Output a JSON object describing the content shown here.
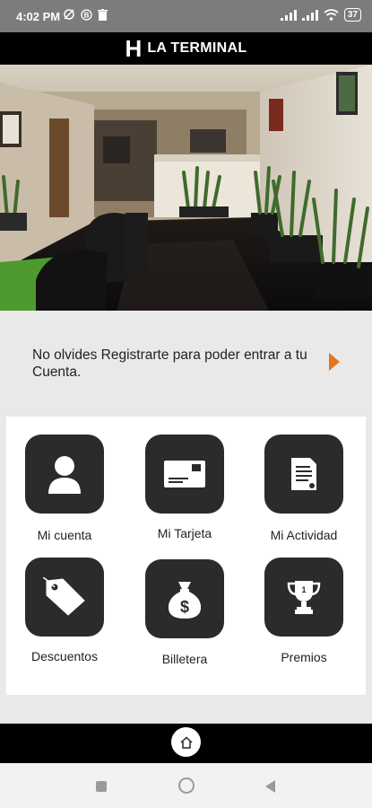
{
  "status_bar": {
    "time": "4:02 PM",
    "battery": "37",
    "icons": [
      "no-sync-icon",
      "b-badge-icon",
      "trash-icon",
      "signal-icon",
      "signal-icon",
      "wifi-icon",
      "battery-icon"
    ]
  },
  "header": {
    "logo_letter": "H",
    "title": "LA TERMINAL"
  },
  "banner": {
    "text": "No olvides Registrarte para poder entrar a tu Cuenta."
  },
  "tiles": [
    {
      "label": "Mi cuenta",
      "icon": "user-icon"
    },
    {
      "label": "Mi Tarjeta",
      "icon": "card-icon"
    },
    {
      "label": "Mi Actividad",
      "icon": "document-icon"
    },
    {
      "label": "Descuentos",
      "icon": "tag-icon"
    },
    {
      "label": "Billetera",
      "icon": "money-bag-icon"
    },
    {
      "label": "Premios",
      "icon": "trophy-icon"
    }
  ],
  "bottom_nav": {
    "home_icon": "home-icon"
  },
  "colors": {
    "tile_bg": "#2b2b2b",
    "accent_arrow": "#e8731a",
    "header_bg": "#000000"
  }
}
